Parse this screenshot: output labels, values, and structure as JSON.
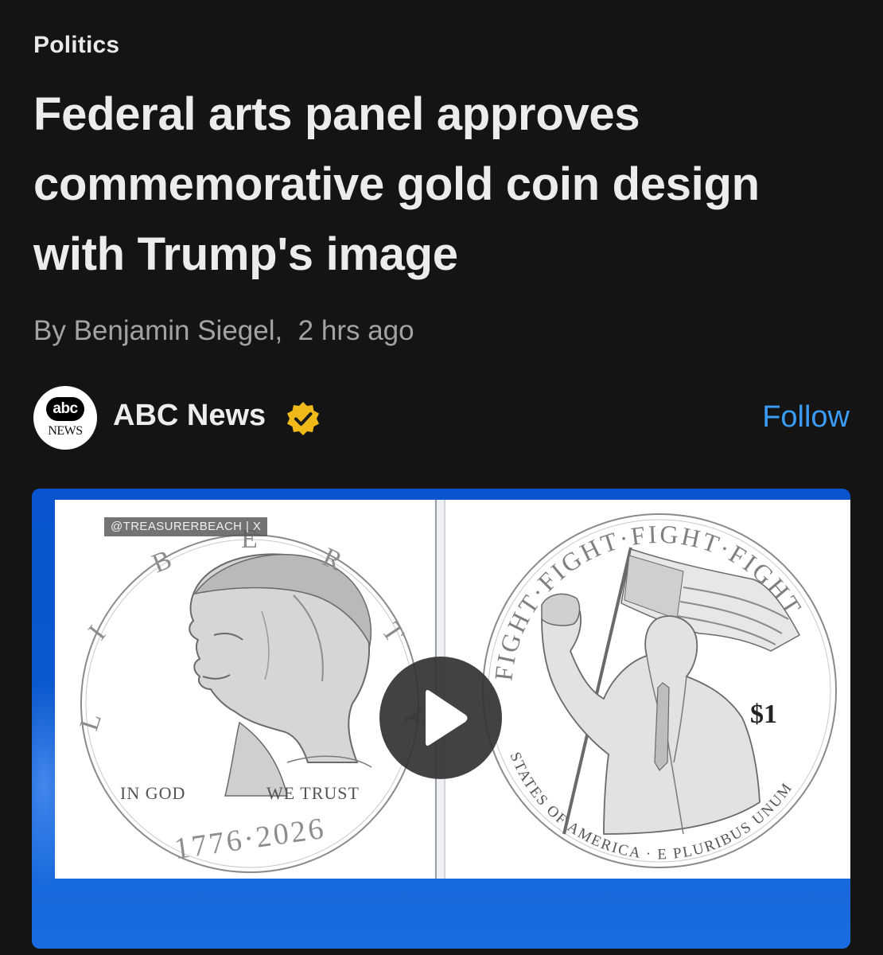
{
  "article": {
    "category": "Politics",
    "headline": "Federal arts panel approves commemorative gold coin design with Trump's image",
    "byline": "By Benjamin Siegel,  2 hrs ago"
  },
  "publisher": {
    "name": "ABC News",
    "logo_top": "abc",
    "logo_bottom": "NEWS",
    "follow_label": "Follow",
    "verified_icon": "verified-badge-icon",
    "verified_color": "#f0b91a",
    "follow_color": "#3b9cf6"
  },
  "media": {
    "type": "video",
    "watermark": "@TREASURERBEACH | X",
    "background_color": "#0b58cf",
    "play_icon": "play-icon",
    "coin_front": {
      "rim_letters": [
        "L",
        "I",
        "B",
        "E",
        "R",
        "T",
        "Y"
      ],
      "motto_left": "IN GOD",
      "motto_right": "WE TRUST",
      "years": "1776·2026"
    },
    "coin_back": {
      "rim_top": "FIGHT·FIGHT·FIGHT·FIGHT",
      "rim_bottom": "STATES OF AMERICA · E PLURIBUS UNUM",
      "denomination": "$1"
    }
  }
}
